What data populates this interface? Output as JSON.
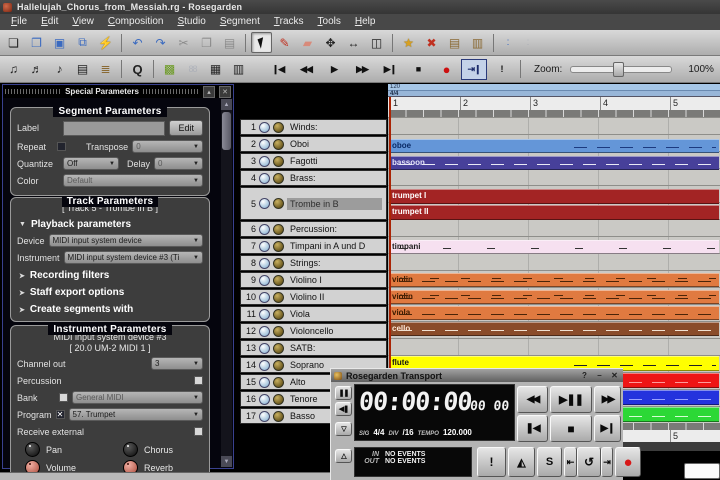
{
  "window": {
    "title": "Hallelujah_Chorus_from_Messiah.rg - Rosegarden"
  },
  "menu": {
    "items": [
      "File",
      "Edit",
      "View",
      "Composition",
      "Studio",
      "Segment",
      "Tracks",
      "Tools",
      "Help"
    ]
  },
  "toolbar_main": {
    "icons": [
      {
        "name": "new-file",
        "glyph": "❏"
      },
      {
        "name": "open-file",
        "glyph": "❐"
      },
      {
        "name": "save-file",
        "glyph": "▣"
      },
      {
        "name": "print-preview",
        "glyph": "⧉"
      },
      {
        "name": "import-file",
        "glyph": "⚡"
      },
      {
        "name": "undo",
        "glyph": "↶"
      },
      {
        "name": "redo",
        "glyph": "↷"
      },
      {
        "name": "cut",
        "glyph": "✂"
      },
      {
        "name": "copy",
        "glyph": "❐"
      },
      {
        "name": "paste",
        "glyph": "▤"
      },
      {
        "name": "draw-tool",
        "glyph": "✎"
      },
      {
        "name": "erase-tool",
        "glyph": "▰"
      },
      {
        "name": "move-tool",
        "glyph": "✥"
      },
      {
        "name": "resize-tool",
        "glyph": "↔"
      },
      {
        "name": "split-tool",
        "glyph": "◫"
      },
      {
        "name": "add-track",
        "glyph": "★"
      },
      {
        "name": "delete-track",
        "glyph": "✖"
      },
      {
        "name": "mute-all",
        "glyph": "▤"
      },
      {
        "name": "unmute-all",
        "glyph": "▥"
      },
      {
        "name": "move-track-up",
        "glyph": ":"
      },
      {
        "name": "move-track-down",
        "glyph": ":"
      }
    ]
  },
  "toolbar_secondary": {
    "icons": [
      {
        "name": "notation-editor",
        "glyph": "♫"
      },
      {
        "name": "notation-editor-alt",
        "glyph": "♬"
      },
      {
        "name": "matrix-editor",
        "glyph": "♪"
      },
      {
        "name": "event-list-editor",
        "glyph": "▤"
      },
      {
        "name": "tempo-ruler",
        "glyph": "≣"
      },
      {
        "name": "quantize",
        "glyph": "Q"
      },
      {
        "name": "piano-roll",
        "glyph": "▩"
      },
      {
        "name": "percussion-matrix",
        "glyph": "88"
      },
      {
        "name": "keyboard",
        "glyph": "▦"
      },
      {
        "name": "drum",
        "glyph": "▥"
      }
    ],
    "transport": [
      {
        "name": "skip-to-start",
        "glyph": "❙◀"
      },
      {
        "name": "rewind",
        "glyph": "◀◀"
      },
      {
        "name": "play",
        "glyph": "▶"
      },
      {
        "name": "fast-forward",
        "glyph": "▶▶"
      },
      {
        "name": "skip-to-end",
        "glyph": "▶❙"
      },
      {
        "name": "stop",
        "glyph": "■"
      },
      {
        "name": "record",
        "glyph": "●"
      },
      {
        "name": "punch-in-record",
        "glyph": "⇥❙"
      },
      {
        "name": "solo",
        "glyph": "!"
      }
    ],
    "zoom": {
      "label": "Zoom:",
      "value": "100%"
    }
  },
  "special_parameters": {
    "title": "Special Parameters",
    "shade_button": "▴",
    "close_button": "✕",
    "segment_parameters": {
      "title": "Segment Parameters",
      "label_label": "Label",
      "label_value": "",
      "edit_button": "Edit",
      "repeat_label": "Repeat",
      "transpose_label": "Transpose",
      "transpose_value": "0",
      "quantize_label": "Quantize",
      "quantize_value": "Off",
      "delay_label": "Delay",
      "delay_value": "0",
      "color_label": "Color",
      "color_value": "Default"
    },
    "track_parameters": {
      "title": "Track Parameters",
      "subtitle": "[ Track 5 - Trombe in B ]",
      "playback_arrow": "▼",
      "playback_label": "Playback parameters",
      "device_label": "Device",
      "device_value": "MIDI input system device",
      "instrument_label": "Instrument",
      "instrument_value": "MIDI input system device #3 (Ti",
      "recording_arrow": "➤",
      "recording_label": "Recording filters",
      "staff_arrow": "➤",
      "staff_label": "Staff export options",
      "create_arrow": "➤",
      "create_label": "Create segments with"
    },
    "instrument_parameters": {
      "title": "Instrument Parameters",
      "device_line": "MIDI input system device  #3",
      "connection_line": "[ 20.0 UM-2 MIDI 1 ]",
      "channel_out_label": "Channel out",
      "channel_out_value": "3",
      "percussion_label": "Percussion",
      "bank_label": "Bank",
      "bank_value": "General MIDI",
      "program_label": "Program",
      "program_check": "✕",
      "program_value": "57. Trumpet",
      "receive_external_label": "Receive external",
      "knobs": [
        {
          "label": "Pan"
        },
        {
          "label": "Chorus"
        },
        {
          "label": "Volume"
        },
        {
          "label": "Reverb"
        }
      ]
    }
  },
  "tracks": [
    {
      "num": "1",
      "label": "Winds:"
    },
    {
      "num": "2",
      "label": "Oboi"
    },
    {
      "num": "3",
      "label": "Fagotti"
    },
    {
      "num": "4",
      "label": "Brass:"
    },
    {
      "num": "5",
      "label": "Trombe in B",
      "selected": true
    },
    {
      "num": "6",
      "label": "Percussion:"
    },
    {
      "num": "7",
      "label": "Timpani in A und D"
    },
    {
      "num": "8",
      "label": "Strings:"
    },
    {
      "num": "9",
      "label": "Violino I"
    },
    {
      "num": "10",
      "label": "Violino II"
    },
    {
      "num": "11",
      "label": "Viola"
    },
    {
      "num": "12",
      "label": "Violoncello"
    },
    {
      "num": "13",
      "label": "SATB:"
    },
    {
      "num": "14",
      "label": "Soprano"
    },
    {
      "num": "15",
      "label": "Alto"
    },
    {
      "num": "16",
      "label": "Tenore"
    },
    {
      "num": "17",
      "label": "Basso"
    }
  ],
  "canvas": {
    "tempo_marking": "120",
    "time_signature": "4/4",
    "bars": [
      "1",
      "2",
      "3",
      "4",
      "5"
    ],
    "segments": [
      {
        "label": "oboe",
        "color": "#6496d8",
        "text_color": "#0a2a66",
        "notes_color": "#1c3a80"
      },
      {
        "label": "bassoon",
        "color": "#47409a",
        "text_color": "#e6e6fa",
        "notes_color": "#e9e9f6"
      },
      {
        "label": "trumpet I",
        "color": "#a32424",
        "text_color": "#ffffff",
        "notes_color": "#8a1a1a"
      },
      {
        "label": "trumpet II",
        "color": "#a32424",
        "text_color": "#ffffff",
        "notes_color": "#8a1a1a"
      },
      {
        "label": "timpani",
        "color": "#f6e0f0",
        "text_color": "#1a1a1a",
        "notes_color": "#333333"
      },
      {
        "label": "violin",
        "color": "#e07a40",
        "text_color": "#3a1a00",
        "notes_color": "#4a2408"
      },
      {
        "label": "violin",
        "color": "#e07a40",
        "text_color": "#3a1a00",
        "notes_color": "#4a2408"
      },
      {
        "label": "viola",
        "color": "#e07a40",
        "text_color": "#3a1a00",
        "notes_color": "#4a2408"
      },
      {
        "label": "cello",
        "color": "#8a4c2a",
        "text_color": "#ffe9d9",
        "notes_color": "#f0e0d0"
      },
      {
        "label": "flute",
        "color": "#ffff00",
        "text_color": "#111111",
        "notes_color": "#222222"
      },
      {
        "label": "",
        "color": "#ee1515",
        "text_color": "#ffffff",
        "notes_color": "#ff9a9a"
      },
      {
        "label": "",
        "color": "#2433dd",
        "text_color": "#ffffff",
        "notes_color": "#9aa2ff"
      },
      {
        "label": "",
        "color": "#2cd836",
        "text_color": "#ffffff",
        "notes_color": "#d6ffd6"
      }
    ]
  },
  "transport": {
    "title": "Rosegarden Transport",
    "help_button": "?",
    "minimize_button": "–",
    "close_button": "✕",
    "time_display": "00:00:00",
    "time_subdisplay": "00 00",
    "sig_label": "SIG",
    "sig_value": "4/4",
    "div_label": "DIV",
    "div_value": "/16",
    "tempo_label": "TEMPO",
    "tempo_value": "120.000",
    "in_label": "IN",
    "in_value": "NO EVENTS",
    "out_label": "OUT",
    "out_value": "NO EVENTS",
    "buttons": {
      "pause": "❚❚",
      "rewind_to_marker": "◀❚",
      "show_less": "▽",
      "show_more": "△",
      "rewind": "◀◀",
      "play": "▶❚❚",
      "fast_forward": "▶▶",
      "to_start": "❚◀",
      "stop": "■",
      "to_end": "▶❙",
      "solo": "!",
      "metronome": "◭",
      "scroll": "S",
      "loop_start": "⇤",
      "loop": "↺",
      "loop_end": "⇥",
      "record": "●"
    }
  }
}
